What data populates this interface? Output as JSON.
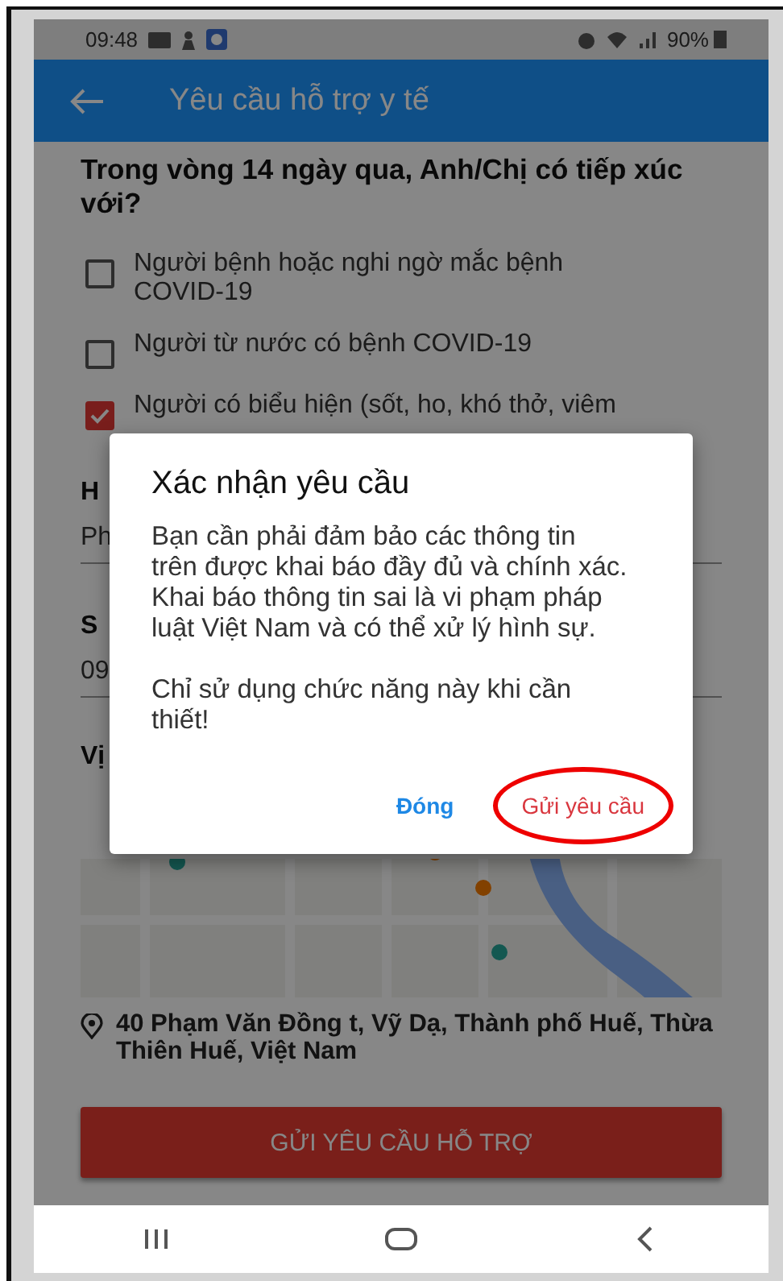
{
  "status_bar": {
    "time": "09:48",
    "battery": "90%"
  },
  "app_bar": {
    "title": "Yêu cầu hỗ trợ y tế"
  },
  "question": "Trong vòng 14 ngày qua, Anh/Chị có tiếp xúc với?",
  "options": [
    {
      "label": "Người bệnh hoặc nghi ngờ mắc bệnh COVID-19",
      "checked": false
    },
    {
      "label": "Người từ nước có bệnh COVID-19",
      "checked": false
    },
    {
      "label": "Người có biểu hiện (sốt, ho, khó thở, viêm",
      "checked": true
    }
  ],
  "fields": [
    {
      "label": "H",
      "value": "Ph"
    },
    {
      "label": "S",
      "value": "09"
    }
  ],
  "location": {
    "label": "Vị",
    "address": "40 Phạm Văn Đồng t, Vỹ Dạ, Thành phố Huế, Thừa Thiên Huế, Việt Nam"
  },
  "submit_button": "GỬI YÊU CẦU HỖ TRỢ",
  "dialog": {
    "title": "Xác nhận yêu cầu",
    "paragraphs": [
      "Bạn cần phải đảm bảo các thông tin trên được khai báo đầy đủ và chính xác. Khai báo thông tin sai là vi phạm pháp luật Việt Nam và có thể xử lý hình sự.",
      "Chỉ sử dụng chức năng này khi cần thiết!"
    ],
    "buttons": [
      {
        "label": "Đóng",
        "kind": "neutral",
        "circled": false
      },
      {
        "label": "Gửi yêu cầu",
        "kind": "confirm",
        "circled": true
      }
    ]
  }
}
